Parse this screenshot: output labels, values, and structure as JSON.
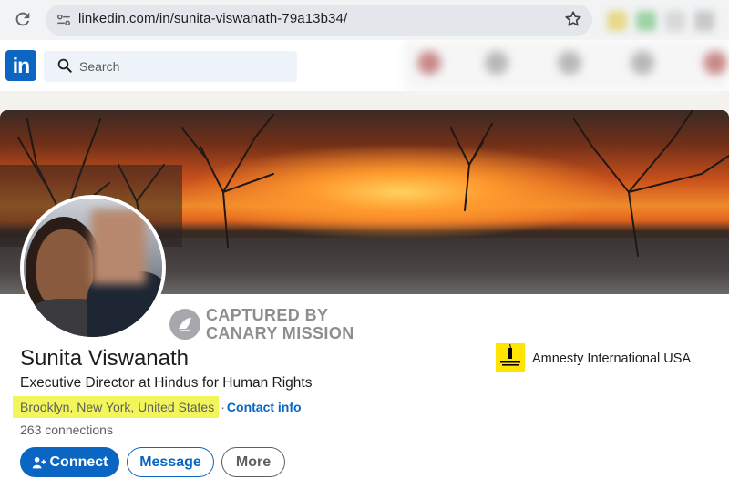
{
  "browser": {
    "url": "linkedin.com/in/sunita-viswanath-79a13b34/"
  },
  "navbar": {
    "logo_text": "in",
    "search_placeholder": "Search"
  },
  "profile": {
    "watermark_line1": "CAPTURED BY",
    "watermark_line2": "CANARY MISSION",
    "name": "Sunita Viswanath",
    "headline": "Executive Director at Hindus for Human Rights",
    "location": "Brooklyn, New York, United States",
    "separator": "·",
    "contact_info": "Contact info",
    "connections": "263 connections",
    "organization": "Amnesty International USA",
    "organization_logo_text": "AMNESTY INTERNATIONAL",
    "actions": {
      "connect": "Connect",
      "message": "Message",
      "more": "More"
    }
  },
  "colors": {
    "brand": "#0a66c2",
    "highlight": "#f3f65a",
    "amnesty_yellow": "#ffe400"
  },
  "icons": [
    "reload-icon",
    "site-info-icon",
    "bookmark-star-icon",
    "search-icon",
    "canary-bird-icon",
    "add-person-icon"
  ]
}
